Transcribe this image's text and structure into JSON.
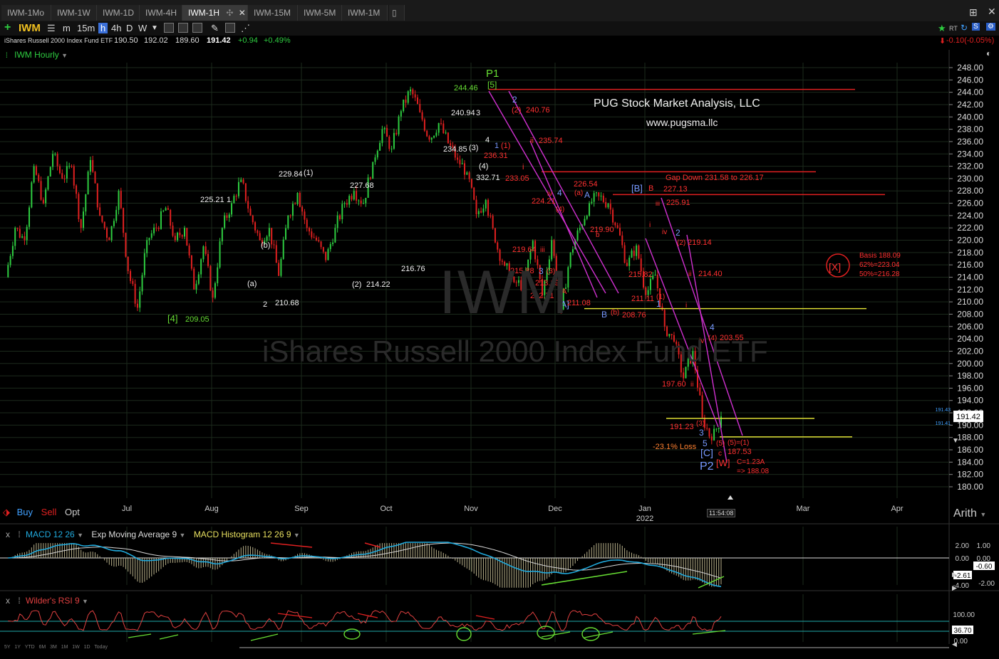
{
  "tabs": [
    "IWM-1Mo",
    "IWM-1W",
    "IWM-1D",
    "IWM-4H",
    "IWM-1H",
    "IWM-15M",
    "IWM-5M",
    "IWM-1M"
  ],
  "toolbar": {
    "symbol": "IWM",
    "intervals": [
      "m",
      "15m",
      "h",
      "4h",
      "D",
      "W"
    ],
    "selected_interval": "h"
  },
  "quote": {
    "name": "iShares Russell 2000 Index Fund ETF",
    "open": "190.50",
    "high": "192.02",
    "low": "189.60",
    "last": "191.42",
    "change": "+0.94",
    "change_pct": "+0.49%",
    "right_change": "-0.10(-0.05%)",
    "rt_label": "RT"
  },
  "chart_title": "IWM Hourly",
  "watermark": {
    "symbol": "IWM",
    "name": "iShares Russell 2000 Index Fund ETF"
  },
  "branding": {
    "company": "PUG Stock Market Analysis, LLC",
    "url": "www.pugsma.llc"
  },
  "trade_buttons": {
    "buy": "Buy",
    "sell": "Sell",
    "opt": "Opt"
  },
  "scale_mode": "Arith",
  "time_label": "11:54:08",
  "colors": {
    "up": "#2ecc40",
    "down": "#e02020",
    "label_red": "#ff3030",
    "label_green": "#66dd33",
    "label_blue": "#7799ff",
    "label_yellow": "#dddd33",
    "magenta": "#d030d0",
    "macd": "#20aadd",
    "ema": "#d8d8d8",
    "hist": "#b8b08a",
    "rsi": "#e04040"
  },
  "chart_data": [
    {
      "type": "line",
      "title": "IWM Hourly",
      "x_ticks": [
        "Jul",
        "Aug",
        "Sep",
        "Oct",
        "Nov",
        "Dec",
        "Jan 2022",
        "Mar",
        "Apr"
      ],
      "y_ticks": [
        180,
        182,
        184,
        186,
        188,
        190,
        192,
        194,
        196,
        198,
        200,
        202,
        204,
        206,
        208,
        210,
        212,
        214,
        216,
        218,
        220,
        222,
        224,
        226,
        228,
        230,
        232,
        234,
        236,
        238,
        240,
        242,
        244,
        246,
        248
      ],
      "ylim": [
        179,
        249
      ],
      "last_price": 191.42,
      "price_path": [
        [
          "Jun",
          214
        ],
        [
          "Jun",
          222
        ],
        [
          "Jun",
          220
        ],
        [
          "Jun",
          232
        ],
        [
          "Jun",
          226
        ],
        [
          "Jun",
          234
        ],
        [
          "Jun",
          230
        ],
        [
          "Jun",
          232
        ],
        [
          "Jun",
          222
        ],
        [
          "Jul",
          233
        ],
        [
          "Jul",
          224
        ],
        [
          "Jul",
          220
        ],
        [
          "Jul",
          228
        ],
        [
          "Jul",
          215
        ],
        [
          "Jul",
          209.05
        ],
        [
          "Jul",
          220
        ],
        [
          "Aug",
          222
        ],
        [
          "Aug",
          225.21
        ],
        [
          "Aug",
          220
        ],
        [
          "Aug",
          222
        ],
        [
          "Aug",
          212
        ],
        [
          "Aug",
          219
        ],
        [
          "Aug",
          210.68
        ],
        [
          "Aug",
          222
        ],
        [
          "Sep",
          226
        ],
        [
          "Sep",
          229.84
        ],
        [
          "Sep",
          224
        ],
        [
          "Sep",
          220
        ],
        [
          "Sep",
          222
        ],
        [
          "Sep",
          214.22
        ],
        [
          "Sep",
          224
        ],
        [
          "Sep",
          227.68
        ],
        [
          "Oct",
          222
        ],
        [
          "Oct",
          220
        ],
        [
          "Oct",
          216.76
        ],
        [
          "Oct",
          222
        ],
        [
          "Oct",
          226
        ],
        [
          "Oct",
          228
        ],
        [
          "Oct",
          226
        ],
        [
          "Nov",
          232.71
        ],
        [
          "Nov",
          238
        ],
        [
          "Nov",
          234.85
        ],
        [
          "Nov",
          240.94
        ],
        [
          "Nov",
          244.46
        ],
        [
          "Nov",
          240.76
        ],
        [
          "Nov",
          236.31
        ],
        [
          "Nov",
          239
        ],
        [
          "Nov",
          235.74
        ],
        [
          "Nov",
          233.05
        ],
        [
          "Nov",
          231
        ],
        [
          "Dec",
          224.21
        ],
        [
          "Dec",
          226.54
        ],
        [
          "Dec",
          219.64
        ],
        [
          "Dec",
          215.88
        ],
        [
          "Dec",
          213.19
        ],
        [
          "Dec",
          212.71
        ],
        [
          "Dec",
          219.9
        ],
        [
          "Dec",
          211.08
        ],
        [
          "Dec",
          220
        ],
        [
          "Dec",
          208.76
        ],
        [
          "Dec",
          218
        ],
        [
          "Dec",
          222
        ],
        [
          "Dec",
          226
        ],
        [
          "Jan",
          227.13
        ],
        [
          "Jan",
          225.91
        ],
        [
          "Jan",
          222
        ],
        [
          "Jan",
          215.82
        ],
        [
          "Jan",
          219.14
        ],
        [
          "Jan",
          211.11
        ],
        [
          "Jan",
          214.4
        ],
        [
          "Jan",
          206
        ],
        [
          "Jan",
          203.55
        ],
        [
          "Jan",
          197.6
        ],
        [
          "Jan",
          202
        ],
        [
          "Jan",
          191.23
        ],
        [
          "Jan",
          187.53
        ],
        [
          "Jan",
          191.42
        ]
      ],
      "annotations": [
        {
          "text": "P1",
          "color": "green"
        },
        {
          "text": "[5]",
          "color": "green"
        },
        {
          "text": "244.46",
          "color": "green"
        },
        {
          "text": "[4]",
          "color": "green"
        },
        {
          "text": "209.05",
          "color": "green"
        },
        {
          "text": "225.21",
          "color": "white"
        },
        {
          "text": "1",
          "color": "white"
        },
        {
          "text": "229.84",
          "color": "white"
        },
        {
          "text": "(1)",
          "color": "white"
        },
        {
          "text": "227.68",
          "color": "white"
        },
        {
          "text": "(b)",
          "color": "white"
        },
        {
          "text": "(a)",
          "color": "white"
        },
        {
          "text": "2",
          "color": "white"
        },
        {
          "text": "210.68",
          "color": "white"
        },
        {
          "text": "(2)",
          "color": "white"
        },
        {
          "text": "214.22",
          "color": "white"
        },
        {
          "text": "216.76",
          "color": "white"
        },
        {
          "text": "240.94",
          "color": "white"
        },
        {
          "text": "3",
          "color": "white"
        },
        {
          "text": "234.85",
          "color": "white"
        },
        {
          "text": "(3)",
          "color": "white"
        },
        {
          "text": "4",
          "color": "white"
        },
        {
          "text": "(4)",
          "color": "white"
        },
        {
          "text": "332.71",
          "color": "white"
        },
        {
          "text": "2",
          "color": "blue"
        },
        {
          "text": "1",
          "color": "blue"
        },
        {
          "text": "(1)",
          "color": "red"
        },
        {
          "text": "(2)",
          "color": "red"
        },
        {
          "text": "240.76",
          "color": "red"
        },
        {
          "text": "236.31",
          "color": "red"
        },
        {
          "text": "ii",
          "color": "red"
        },
        {
          "text": "235.74",
          "color": "red"
        },
        {
          "text": "i",
          "color": "red"
        },
        {
          "text": "233.05",
          "color": "red"
        },
        {
          "text": "4",
          "color": "blue"
        },
        {
          "text": "(a)",
          "color": "red"
        },
        {
          "text": "226.54",
          "color": "red"
        },
        {
          "text": "A",
          "color": "blue"
        },
        {
          "text": "iv",
          "color": "red"
        },
        {
          "text": "224.21",
          "color": "red"
        },
        {
          "text": "(4)",
          "color": "red"
        },
        {
          "text": "b",
          "color": "red"
        },
        {
          "text": "219.90",
          "color": "red"
        },
        {
          "text": "219.64",
          "color": "red"
        },
        {
          "text": "iii",
          "color": "red"
        },
        {
          "text": "215.88",
          "color": "red"
        },
        {
          "text": "3",
          "color": "blue"
        },
        {
          "text": "(3)",
          "color": "red"
        },
        {
          "text": "213.19",
          "color": "red"
        },
        {
          "text": "212.71",
          "color": "red"
        },
        {
          "text": "A",
          "color": "red"
        },
        {
          "text": "[A]",
          "color": "blue"
        },
        {
          "text": "211.08",
          "color": "red"
        },
        {
          "text": "B",
          "color": "blue"
        },
        {
          "text": "(b)",
          "color": "red"
        },
        {
          "text": "208.76",
          "color": "red"
        },
        {
          "text": "[B]",
          "color": "blue"
        },
        {
          "text": "B",
          "color": "red"
        },
        {
          "text": "227.13",
          "color": "red"
        },
        {
          "text": "iii",
          "color": "red"
        },
        {
          "text": "225.91",
          "color": "red"
        },
        {
          "text": "i",
          "color": "red"
        },
        {
          "text": "iv",
          "color": "red"
        },
        {
          "text": "2",
          "color": "blue"
        },
        {
          "text": "(2)",
          "color": "red"
        },
        {
          "text": "219.14",
          "color": "red"
        },
        {
          "text": "215.82",
          "color": "red"
        },
        {
          "text": "ii",
          "color": "red"
        },
        {
          "text": "214.40",
          "color": "red"
        },
        {
          "text": "211.11",
          "color": "red"
        },
        {
          "text": "(1)",
          "color": "red"
        },
        {
          "text": "1",
          "color": "blue"
        },
        {
          "text": "i",
          "color": "red"
        },
        {
          "text": "4",
          "color": "blue"
        },
        {
          "text": "(4)",
          "color": "red"
        },
        {
          "text": "203.55",
          "color": "red"
        },
        {
          "text": "iv",
          "color": "red"
        },
        {
          "text": "197.60",
          "color": "red"
        },
        {
          "text": "ii",
          "color": "red"
        },
        {
          "text": "191.23",
          "color": "red"
        },
        {
          "text": "(3)",
          "color": "red"
        },
        {
          "text": "3",
          "color": "blue"
        },
        {
          "text": "5",
          "color": "blue"
        },
        {
          "text": "(5)",
          "color": "red"
        },
        {
          "text": "(5)=(1)",
          "color": "red"
        },
        {
          "text": "187.53",
          "color": "red"
        },
        {
          "text": "-23.1% Loss",
          "color": "orange"
        },
        {
          "text": "[C]",
          "color": "blue"
        },
        {
          "text": "c",
          "color": "red"
        },
        {
          "text": "P2",
          "color": "blue"
        },
        {
          "text": "[W]",
          "color": "red"
        },
        {
          "text": "C=1.23A",
          "color": "red"
        },
        {
          "text": "=> 188.08",
          "color": "red"
        },
        {
          "text": "Gap Down 231.58 to 226.17",
          "color": "red"
        },
        {
          "text": "[X]",
          "color": "red"
        },
        {
          "text": "Basis 188.09",
          "color": "red"
        },
        {
          "text": "62%=223.04",
          "color": "red"
        },
        {
          "text": "50%=216.28",
          "color": "red"
        }
      ],
      "horizontal_lines": [
        {
          "value": 244.46,
          "color": "red"
        },
        {
          "value": 231.1,
          "color": "red"
        },
        {
          "value": 227.4,
          "color": "red"
        },
        {
          "value": 208.9,
          "color": "yellow"
        },
        {
          "value": 191.1,
          "color": "yellow"
        },
        {
          "value": 188.1,
          "color": "yellow"
        }
      ]
    },
    {
      "type": "line",
      "title": "MACD 12 26",
      "series": [
        {
          "name": "MACD 12 26"
        },
        {
          "name": "Exp Moving Average 9"
        },
        {
          "name": "MACD Histogram 12 26 9"
        }
      ],
      "y_ticks": [
        "2.00",
        "0.00",
        "-2.00",
        "-4.00"
      ],
      "right_labels": [
        "1.00",
        "0.00",
        "-0.60",
        "-2.61",
        "-2.00"
      ]
    },
    {
      "type": "line",
      "title": "Wilder's RSI 9",
      "y_ticks": [
        "100.00",
        "36.70",
        "0.00"
      ],
      "last_value": "36.70"
    }
  ],
  "bottom_ranges": [
    "5Y",
    "1Y",
    "YTD",
    "6M",
    "3M",
    "1M",
    "1W",
    "1D",
    "Today"
  ],
  "right_edge_labels": {
    "top": "191.43",
    "bottom": "191.41"
  }
}
